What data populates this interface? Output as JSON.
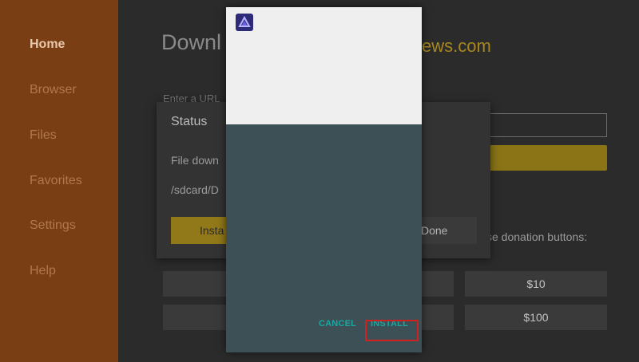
{
  "sidebar": {
    "items": [
      {
        "label": "Home",
        "active": true
      },
      {
        "label": "Browser",
        "active": false
      },
      {
        "label": "Files",
        "active": false
      },
      {
        "label": "Favorites",
        "active": false
      },
      {
        "label": "Settings",
        "active": false
      },
      {
        "label": "Help",
        "active": false
      }
    ]
  },
  "background": {
    "page_title": "Downl",
    "brand_title": "ews.com",
    "url_label": "Enter a URL",
    "donation_text": "se donation buttons:",
    "donation_buttons": [
      "$10",
      "$100"
    ]
  },
  "status_dialog": {
    "title": "Status",
    "line1": "File down",
    "line2": "/sdcard/D",
    "install_label": "Insta",
    "done_label": "Done"
  },
  "installer": {
    "icon": "app-logo-icon",
    "cancel_label": "CANCEL",
    "install_label": "INSTALL"
  },
  "colors": {
    "sidebar": "#7a3e14",
    "accent_teal": "#1aa7a1",
    "highlight_red": "#d02020",
    "gold": "#a8871e"
  }
}
